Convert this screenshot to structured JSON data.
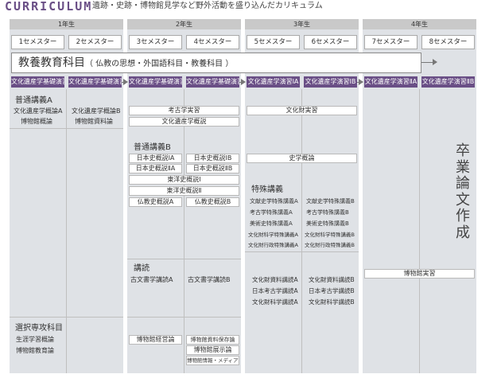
{
  "header": {
    "logo": "CURRICULUM",
    "subtitle": "遺跡・史跡・博物館見学など野外活動を盛り込んだカリキュラム"
  },
  "years": [
    "1年生",
    "2年生",
    "3年生",
    "4年生"
  ],
  "semesters": [
    "1セメスター",
    "2セメスター",
    "3セメスター",
    "4セメスター",
    "5セメスター",
    "6セメスター",
    "7セメスター",
    "8セメスター"
  ],
  "liberal": {
    "main": "教養教育科目",
    "detail": "（ 仏教の思想・外国語科目・教養科目 ）"
  },
  "seminars": [
    "文化遺産学基礎演習A",
    "文化遺産学基礎演習B",
    "文化遺産学基礎演習C",
    "文化遺産学基礎演習D",
    "文化遺産学演習ⅠA",
    "文化遺産学演習ⅠB",
    "文化遺産学演習ⅡA",
    "文化遺産学演習ⅡB"
  ],
  "general_a": {
    "heading": "普通講義A",
    "items": [
      "文化遺産学概論A",
      "博物館概論",
      "文化遺産学概論B",
      "博物館資料論"
    ]
  },
  "year2_top": [
    "考古学実習",
    "文化遺産学概説"
  ],
  "culture_practice": "文化財実習",
  "general_b": {
    "heading": "普通講義B",
    "items": [
      "日本史概説ⅠA",
      "日本史概説ⅠB",
      "日本史概説ⅡA",
      "日本史概説ⅡB",
      "東洋史概説Ⅰ",
      "東洋史概説Ⅱ",
      "仏教史概説A",
      "仏教史概説B"
    ]
  },
  "history_survey": "史学概論",
  "special": {
    "heading": "特殊講義",
    "items": [
      "文献史学特殊講義A",
      "文献史学特殊講義B",
      "考古学特殊講義A",
      "考古学特殊講義B",
      "美術史特殊講義A",
      "美術史特殊講義B",
      "文化財科学特殊講義A",
      "文化財科学特殊講義B",
      "文化財行政特殊講義A",
      "文化財行政特殊講義B"
    ]
  },
  "thesis": "卒業論文作成",
  "museum_practice": "博物館実習",
  "reading": {
    "heading": "講読",
    "items": [
      "古文書学講読A",
      "古文書学講読B"
    ]
  },
  "readings_y3": [
    "文化財資料講読A",
    "文化財資料講読B",
    "日本考古学講読A",
    "日本考古学講読B",
    "文化財科学講読A",
    "文化財科学講読B"
  ],
  "elective": {
    "heading": "選択専攻科目",
    "items": [
      "生涯学習概論",
      "博物館教育論"
    ]
  },
  "museum_y2": [
    "博物館経営論",
    "博物館資料保存論",
    "博物館展示論",
    "博物館情報・メディア論"
  ]
}
